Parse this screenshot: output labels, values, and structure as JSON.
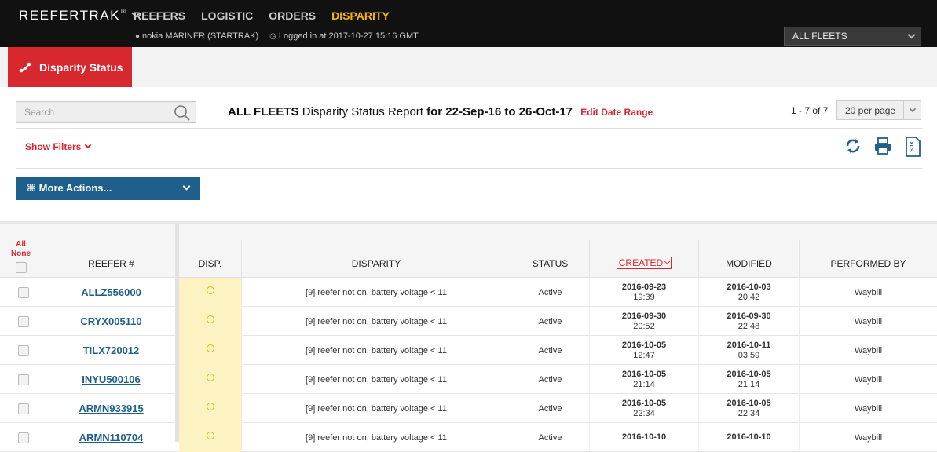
{
  "topbar": {
    "brand": "REEFERTRAK",
    "brand_mark": "®",
    "nav": [
      "REEFERS",
      "LOGISTIC",
      "ORDERS",
      "DISPARITY"
    ],
    "active_nav": "DISPARITY",
    "user": "nokia MARINER (STARTRAK)",
    "login_info": "Logged in at 2017-10-27 15:16 GMT",
    "fleet_select": "ALL FLEETS"
  },
  "tab": {
    "label": "Disparity Status"
  },
  "search": {
    "placeholder": "Search"
  },
  "report": {
    "fleet": "ALL FLEETS",
    "name": "Disparity Status Report",
    "range": "for 22-Sep-16 to 26-Oct-17",
    "edit": "Edit Date Range"
  },
  "pager": {
    "range": "1 - 7 of 7",
    "per_page": "20 per page"
  },
  "filters": {
    "label": "Show Filters"
  },
  "actions": {
    "label": "⌘ More Actions..."
  },
  "table": {
    "all": "All",
    "none": "None",
    "headers": {
      "reefer": "REEFER #",
      "disp": "DISP.",
      "disparity": "DISPARITY",
      "status": "STATUS",
      "created": "CREATED",
      "modified": "MODIFIED",
      "performed_by": "PERFORMED BY"
    },
    "rows": [
      {
        "reefer": "ALLZ556000",
        "disparity": "[9] reefer not on, battery voltage < 11",
        "status": "Active",
        "created_date": "2016-09-23",
        "created_time": "19:39",
        "modified_date": "2016-10-03",
        "modified_time": "20:42",
        "performed_by": "Waybill"
      },
      {
        "reefer": "CRYX005110",
        "disparity": "[9] reefer not on, battery voltage < 11",
        "status": "Active",
        "created_date": "2016-09-30",
        "created_time": "20:52",
        "modified_date": "2016-09-30",
        "modified_time": "22:48",
        "performed_by": "Waybill"
      },
      {
        "reefer": "TILX720012",
        "disparity": "[9] reefer not on, battery voltage < 11",
        "status": "Active",
        "created_date": "2016-10-05",
        "created_time": "12:47",
        "modified_date": "2016-10-11",
        "modified_time": "03:59",
        "performed_by": "Waybill"
      },
      {
        "reefer": "INYU500106",
        "disparity": "[9] reefer not on, battery voltage < 11",
        "status": "Active",
        "created_date": "2016-10-05",
        "created_time": "21:14",
        "modified_date": "2016-10-05",
        "modified_time": "21:14",
        "performed_by": "Waybill"
      },
      {
        "reefer": "ARMN933915",
        "disparity": "[9] reefer not on, battery voltage < 11",
        "status": "Active",
        "created_date": "2016-10-05",
        "created_time": "22:34",
        "modified_date": "2016-10-05",
        "modified_time": "22:34",
        "performed_by": "Waybill"
      },
      {
        "reefer": "ARMN110704",
        "disparity": "[9] reefer not on, battery voltage < 11",
        "status": "Active",
        "created_date": "2016-10-10",
        "created_time": "",
        "modified_date": "2016-10-10",
        "modified_time": "",
        "performed_by": "Waybill"
      }
    ]
  },
  "colors": {
    "accent_red": "#d7282f",
    "nav_active": "#f5b700",
    "button_blue": "#1f5f8b",
    "disp_bg": "#fdf3c2"
  }
}
